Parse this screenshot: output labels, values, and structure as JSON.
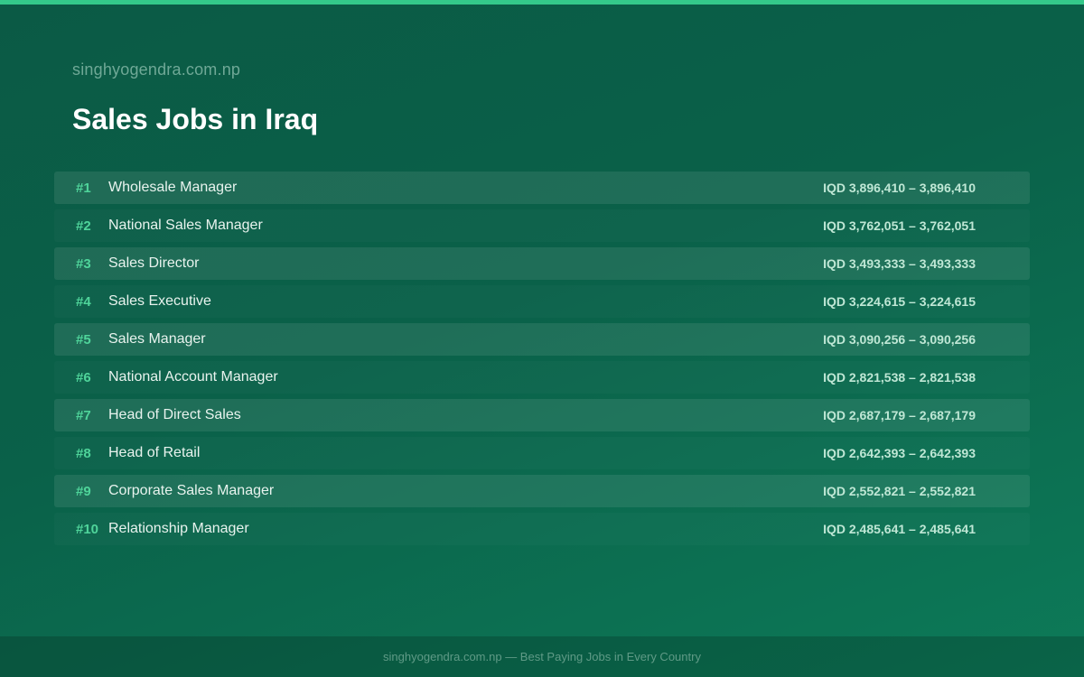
{
  "site_name": "singhyogendra.com.np",
  "title": "Sales Jobs in Iraq",
  "jobs": [
    {
      "rank": "#1",
      "title": "Wholesale Manager",
      "salary": "IQD 3,896,410 – 3,896,410"
    },
    {
      "rank": "#2",
      "title": "National Sales Manager",
      "salary": "IQD 3,762,051 – 3,762,051"
    },
    {
      "rank": "#3",
      "title": "Sales Director",
      "salary": "IQD 3,493,333 – 3,493,333"
    },
    {
      "rank": "#4",
      "title": "Sales Executive",
      "salary": "IQD 3,224,615 – 3,224,615"
    },
    {
      "rank": "#5",
      "title": "Sales Manager",
      "salary": "IQD 3,090,256 – 3,090,256"
    },
    {
      "rank": "#6",
      "title": "National Account Manager",
      "salary": "IQD 2,821,538 – 2,821,538"
    },
    {
      "rank": "#7",
      "title": "Head of Direct Sales",
      "salary": "IQD 2,687,179 – 2,687,179"
    },
    {
      "rank": "#8",
      "title": "Head of Retail",
      "salary": "IQD 2,642,393 – 2,642,393"
    },
    {
      "rank": "#9",
      "title": "Corporate Sales Manager",
      "salary": "IQD 2,552,821 – 2,552,821"
    },
    {
      "rank": "#10",
      "title": "Relationship Manager",
      "salary": "IQD 2,485,641 – 2,485,641"
    }
  ],
  "footer": "singhyogendra.com.np — Best Paying Jobs in Every Country",
  "colors": {
    "accent": "#34c98a",
    "rank": "#4fd49a",
    "background": "#0a6149"
  }
}
